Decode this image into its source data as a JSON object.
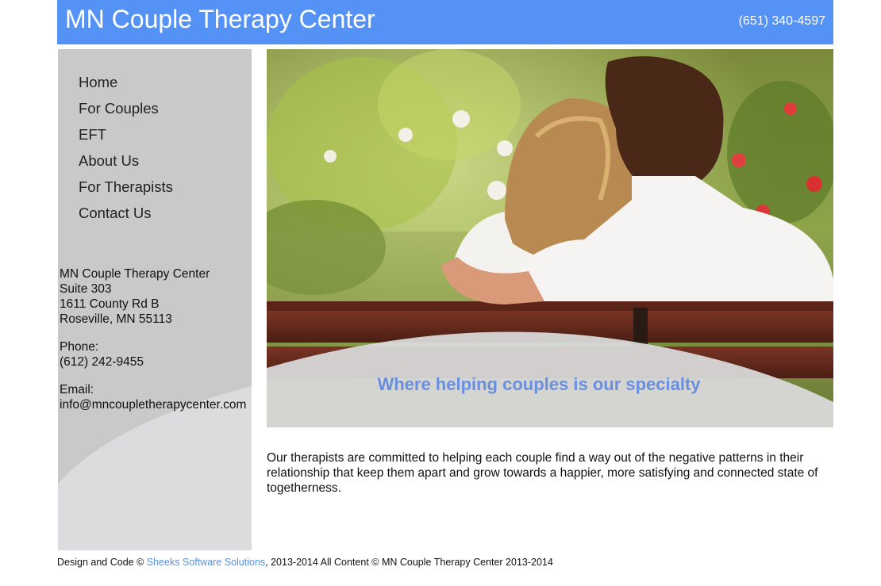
{
  "header": {
    "title": "MN Couple Therapy Center",
    "phone": "(651) 340-4597"
  },
  "nav": {
    "items": [
      {
        "label": "Home"
      },
      {
        "label": "For Couples"
      },
      {
        "label": "EFT"
      },
      {
        "label": "About Us"
      },
      {
        "label": "For Therapists"
      },
      {
        "label": "Contact Us"
      }
    ]
  },
  "contact": {
    "name": "MN Couple Therapy Center",
    "suite": "Suite 303",
    "street": "1611 County Rd B",
    "city": "Roseville, MN 55113",
    "phone_label": "Phone:",
    "phone": "(612) 242-9455",
    "email_label": "Email:",
    "email": "info@mncoupletherapycenter.com"
  },
  "hero": {
    "tagline": "Where helping couples is our specialty"
  },
  "intro": {
    "text": "Our therapists are committed to helping each couple find a way out of the negative patterns in their relationship that keep them apart and grow towards a happier, more satisfying and connected state of togetherness."
  },
  "footer": {
    "prefix": "Design and Code © ",
    "link": "Sheeks Software Solutions",
    "suffix": ", 2013-2014 All Content © MN Couple Therapy Center 2013-2014"
  },
  "colors": {
    "header_bg": "#5592f5",
    "sidebar_bg": "#c9c9c9",
    "tagline": "#6a8fde",
    "link": "#5b8fd9"
  }
}
